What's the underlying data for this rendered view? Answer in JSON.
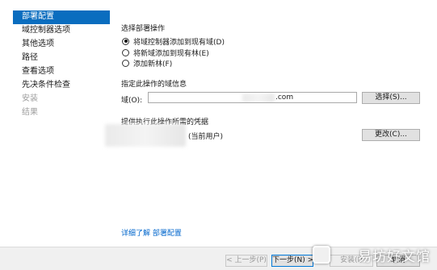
{
  "nav": {
    "items": [
      {
        "label": "部署配置",
        "state": "active"
      },
      {
        "label": "域控制器选项",
        "state": "normal"
      },
      {
        "label": "其他选项",
        "state": "normal"
      },
      {
        "label": "路径",
        "state": "normal"
      },
      {
        "label": "查看选项",
        "state": "normal"
      },
      {
        "label": "先决条件检查",
        "state": "normal"
      },
      {
        "label": "安装",
        "state": "disabled"
      },
      {
        "label": "结果",
        "state": "disabled"
      }
    ]
  },
  "deployment": {
    "heading": "选择部署操作",
    "options": [
      {
        "label": "将域控制器添加到现有域(D)",
        "selected": true
      },
      {
        "label": "将新域添加到现有林(E)",
        "selected": false
      },
      {
        "label": "添加新林(F)",
        "selected": false
      }
    ]
  },
  "domain_info": {
    "heading": "指定此操作的域信息",
    "domain_label": "域(O):",
    "domain_value": ".com",
    "select_button": "选择(S)..."
  },
  "credentials": {
    "heading": "提供执行此操作所需的凭据",
    "current_user_suffix": "(当前用户)",
    "change_button": "更改(C)..."
  },
  "footer": {
    "more_link_prefix": "详细了解",
    "more_link_target": "部署配置",
    "back_button": "< 上一步(P)",
    "next_button": "下一步(N) >",
    "install_button": "安装(I)",
    "cancel_button": "取消"
  },
  "watermark": "易坊好文馆",
  "colors": {
    "accent": "#0a6dbf",
    "link": "#0066cc",
    "footer_bg": "#f0f0f0"
  }
}
